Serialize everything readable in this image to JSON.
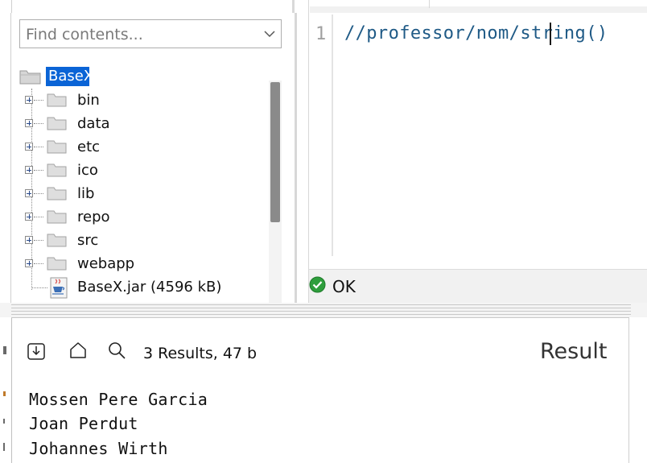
{
  "file_tree": {
    "search_placeholder": "Find contents...",
    "root_label": "BaseX",
    "folders": [
      "bin",
      "data",
      "etc",
      "ico",
      "lib",
      "repo",
      "src",
      "webapp"
    ],
    "file_label": "BaseX.jar (4596 kB)"
  },
  "editor": {
    "line_number": "1",
    "code": "//professor/nom/string()"
  },
  "status": {
    "text": "OK",
    "color": "#2e9e3c"
  },
  "results": {
    "count": "3 Results, 47 b",
    "title": "Result",
    "lines": [
      "Mossen Pere Garcia",
      "Joan Perdut",
      "Johannes Wirth"
    ]
  },
  "colors": {
    "selection": "#0a64d6",
    "code_text": "#1f5a86"
  },
  "icons": [
    "chevron-down-icon",
    "folder-icon",
    "jar-file-icon",
    "ok-check-icon",
    "export-icon",
    "home-icon",
    "search-icon"
  ]
}
